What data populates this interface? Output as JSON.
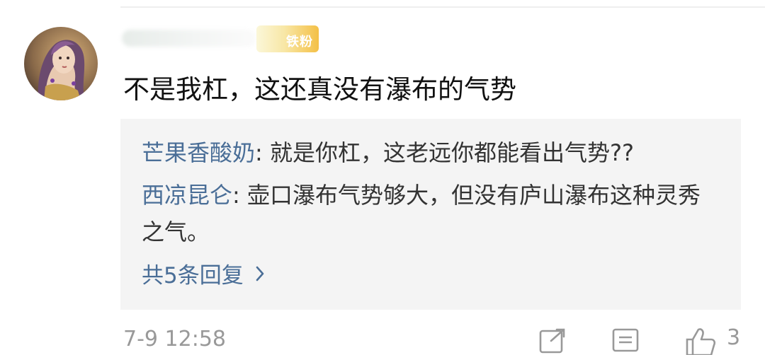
{
  "comment": {
    "fan_badge_label": "铁粉",
    "text": "不是我杠，这还真没有瀑布的气势",
    "timestamp": "7-9 12:58"
  },
  "replies": [
    {
      "user": "芒果香酸奶",
      "separator": ": ",
      "text": "就是你杠，这老远你都能看出气势??"
    },
    {
      "user": "西凉昆仑",
      "separator": ": ",
      "text": "壶口瀑布气势够大，但没有庐山瀑布这种灵秀之气。"
    }
  ],
  "more_replies_label": "共5条回复",
  "actions": {
    "share_icon": "share-icon",
    "comment_icon": "comment-icon",
    "like_icon": "thumbs-up-icon",
    "like_count": "3"
  },
  "colors": {
    "link_blue": "#4a6e97",
    "reply_background": "#f4f4f4",
    "muted_gray": "#999999"
  }
}
